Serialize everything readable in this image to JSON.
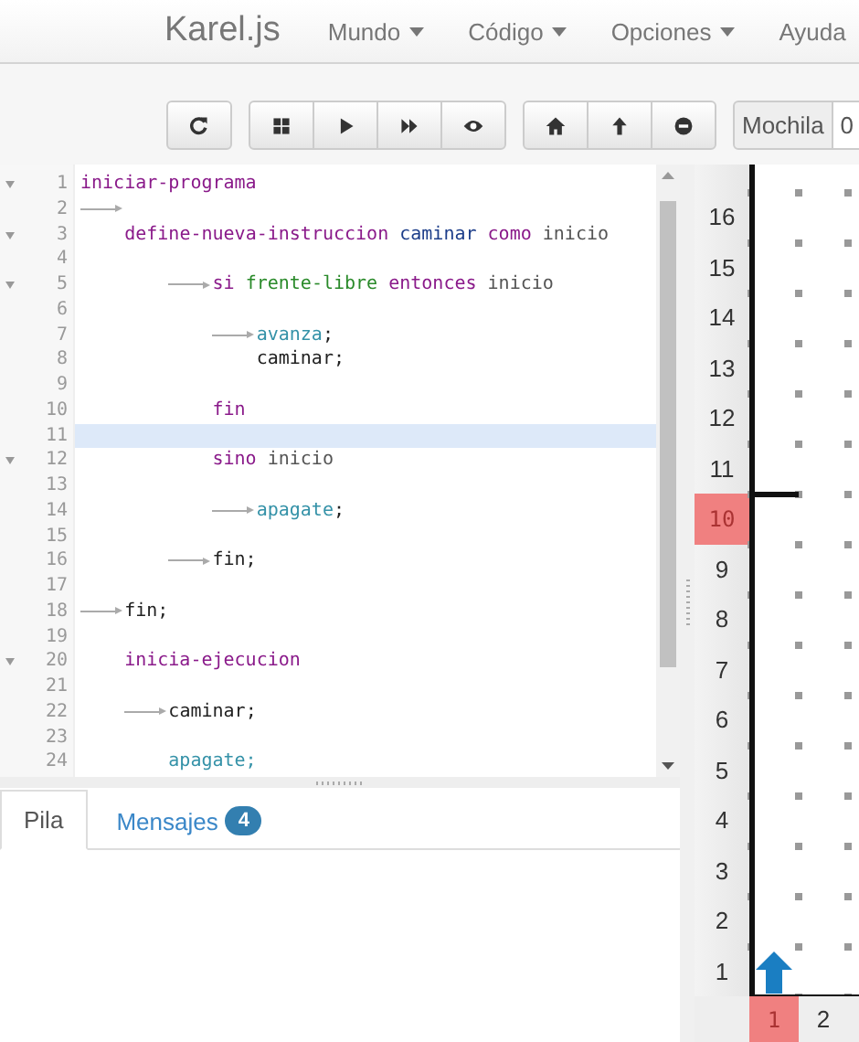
{
  "navbar": {
    "brand": "Karel.js",
    "menus": [
      {
        "label": "Mundo",
        "dropdown": true
      },
      {
        "label": "Código",
        "dropdown": true
      },
      {
        "label": "Opciones",
        "dropdown": true
      },
      {
        "label": "Ayuda",
        "dropdown": false
      }
    ]
  },
  "toolbar": {
    "backpack": {
      "label": "Mochila",
      "value": "0"
    }
  },
  "editor": {
    "lines": [
      {
        "number": "1",
        "fold": true,
        "active": false,
        "tokens": [
          {
            "kind": "keyword",
            "text": "iniciar-programa"
          }
        ]
      },
      {
        "number": "2",
        "fold": false,
        "active": false,
        "tokens": [
          {
            "kind": "tab_marker"
          }
        ]
      },
      {
        "number": "3",
        "fold": true,
        "active": false,
        "tokens": [
          {
            "kind": "tab"
          },
          {
            "kind": "keyword",
            "text": "define-nueva-instruccion"
          },
          {
            "kind": "name",
            "text": " caminar"
          },
          {
            "kind": "keyword",
            "text": " como"
          },
          {
            "kind": "plain",
            "text": " inicio"
          }
        ]
      },
      {
        "number": "4",
        "fold": false,
        "active": false
      },
      {
        "number": "5",
        "fold": true,
        "active": false,
        "tokens": [
          {
            "kind": "tab"
          },
          {
            "kind": "tab"
          },
          {
            "kind": "tab_marker"
          },
          {
            "kind": "keyword",
            "text": "si"
          },
          {
            "kind": "condition",
            "text": " frente-libre"
          },
          {
            "kind": "keyword",
            "text": " entonces"
          },
          {
            "kind": "plain",
            "text": " inicio"
          }
        ]
      },
      {
        "number": "6",
        "fold": false,
        "active": false
      },
      {
        "number": "7",
        "fold": false,
        "active": false,
        "tokens": [
          {
            "kind": "tab"
          },
          {
            "kind": "tab"
          },
          {
            "kind": "tab"
          },
          {
            "kind": "tab_marker"
          },
          {
            "kind": "command",
            "text": "avanza"
          },
          {
            "kind": "punct",
            "text": ";"
          }
        ]
      },
      {
        "number": "8",
        "fold": false,
        "active": false,
        "tokens": [
          {
            "kind": "punct",
            "text": "                caminar;"
          }
        ]
      },
      {
        "number": "9",
        "fold": false,
        "active": false
      },
      {
        "number": "10",
        "fold": false,
        "active": false,
        "tokens": [
          {
            "kind": "keyword",
            "text": "            fin"
          }
        ]
      },
      {
        "number": "11",
        "fold": false,
        "active": true
      },
      {
        "number": "12",
        "fold": true,
        "active": false,
        "tokens": [
          {
            "kind": "keyword",
            "text": "            sino"
          },
          {
            "kind": "plain",
            "text": " inicio"
          }
        ]
      },
      {
        "number": "13",
        "fold": false,
        "active": false
      },
      {
        "number": "14",
        "fold": false,
        "active": false,
        "tokens": [
          {
            "kind": "tab"
          },
          {
            "kind": "tab"
          },
          {
            "kind": "tab"
          },
          {
            "kind": "tab_marker"
          },
          {
            "kind": "command",
            "text": "apagate"
          },
          {
            "kind": "punct",
            "text": ";"
          }
        ]
      },
      {
        "number": "15",
        "fold": false,
        "active": false
      },
      {
        "number": "16",
        "fold": false,
        "active": false,
        "tokens": [
          {
            "kind": "tab"
          },
          {
            "kind": "tab"
          },
          {
            "kind": "tab_marker"
          },
          {
            "kind": "punct",
            "text": "fin;"
          }
        ]
      },
      {
        "number": "17",
        "fold": false,
        "active": false
      },
      {
        "number": "18",
        "fold": false,
        "active": false,
        "tokens": [
          {
            "kind": "tab_marker"
          },
          {
            "kind": "punct",
            "text": "fin;"
          }
        ]
      },
      {
        "number": "19",
        "fold": false,
        "active": false
      },
      {
        "number": "20",
        "fold": true,
        "active": false,
        "tokens": [
          {
            "kind": "keyword",
            "text": "    inicia-ejecucion"
          }
        ]
      },
      {
        "number": "21",
        "fold": false,
        "active": false
      },
      {
        "number": "22",
        "fold": false,
        "active": false,
        "tokens": [
          {
            "kind": "tab"
          },
          {
            "kind": "tab_marker"
          },
          {
            "kind": "punct",
            "text": "caminar;"
          }
        ]
      },
      {
        "number": "23",
        "fold": false,
        "active": false
      },
      {
        "number": "24",
        "fold": false,
        "active": false,
        "tokens": [
          {
            "kind": "command",
            "text": "        apagate;"
          }
        ]
      }
    ]
  },
  "tabs": [
    {
      "label": "Pila",
      "selected": true
    },
    {
      "label": "Mensajes",
      "selected": false,
      "badge": "4"
    }
  ],
  "world": {
    "rows": [
      {
        "label": "16",
        "highlighted": false
      },
      {
        "label": "15",
        "highlighted": false
      },
      {
        "label": "14",
        "highlighted": false
      },
      {
        "label": "13",
        "highlighted": false
      },
      {
        "label": "12",
        "highlighted": false
      },
      {
        "label": "11",
        "highlighted": false
      },
      {
        "label": "10",
        "highlighted": true
      },
      {
        "label": "9",
        "highlighted": false
      },
      {
        "label": "8",
        "highlighted": false
      },
      {
        "label": "7",
        "highlighted": false
      },
      {
        "label": "6",
        "highlighted": false
      },
      {
        "label": "5",
        "highlighted": false
      },
      {
        "label": "4",
        "highlighted": false
      },
      {
        "label": "3",
        "highlighted": false
      },
      {
        "label": "2",
        "highlighted": false
      },
      {
        "label": "1",
        "highlighted": false
      }
    ],
    "columns": [
      {
        "label": "1",
        "highlighted": true
      },
      {
        "label": "2",
        "highlighted": false
      }
    ]
  }
}
